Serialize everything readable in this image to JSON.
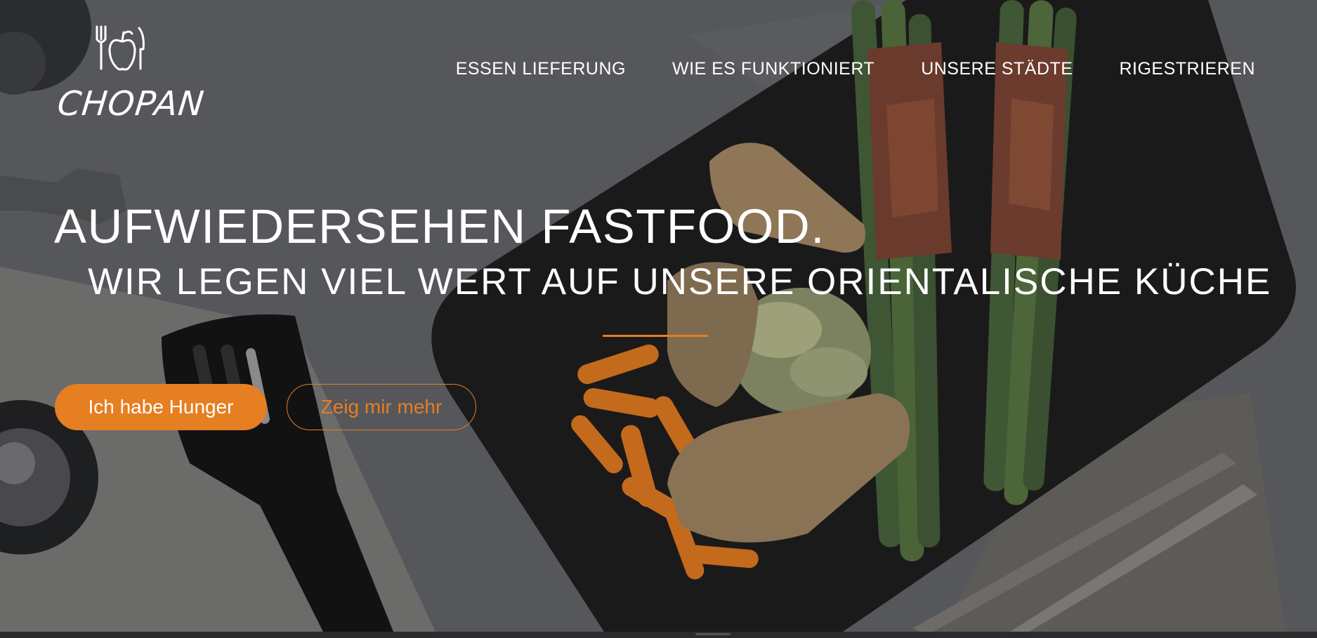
{
  "logo": {
    "text": "CHOPAN",
    "icon": "fork-apple-knife-icon"
  },
  "nav": {
    "items": [
      {
        "label": "ESSEN LIEFERUNG"
      },
      {
        "label": "WIE ES FUNKTIONIERT"
      },
      {
        "label": "UNSERE STÄDTE"
      },
      {
        "label": "RIGESTRIEREN"
      }
    ]
  },
  "hero": {
    "headline": "AUFWIEDERSEHEN FASTFOOD.",
    "subheadline": "WIR LEGEN VIEL WERT AUF UNSERE ORIENTALISCHE KÜCHE",
    "primary_button": "Ich habe Hunger",
    "secondary_button": "Zeig mir mehr",
    "background": "food-photo-plate-chicken-asparagus-carrots"
  },
  "colors": {
    "accent": "#e67e22",
    "text": "#ffffff",
    "overlay": "#3b3d40"
  }
}
